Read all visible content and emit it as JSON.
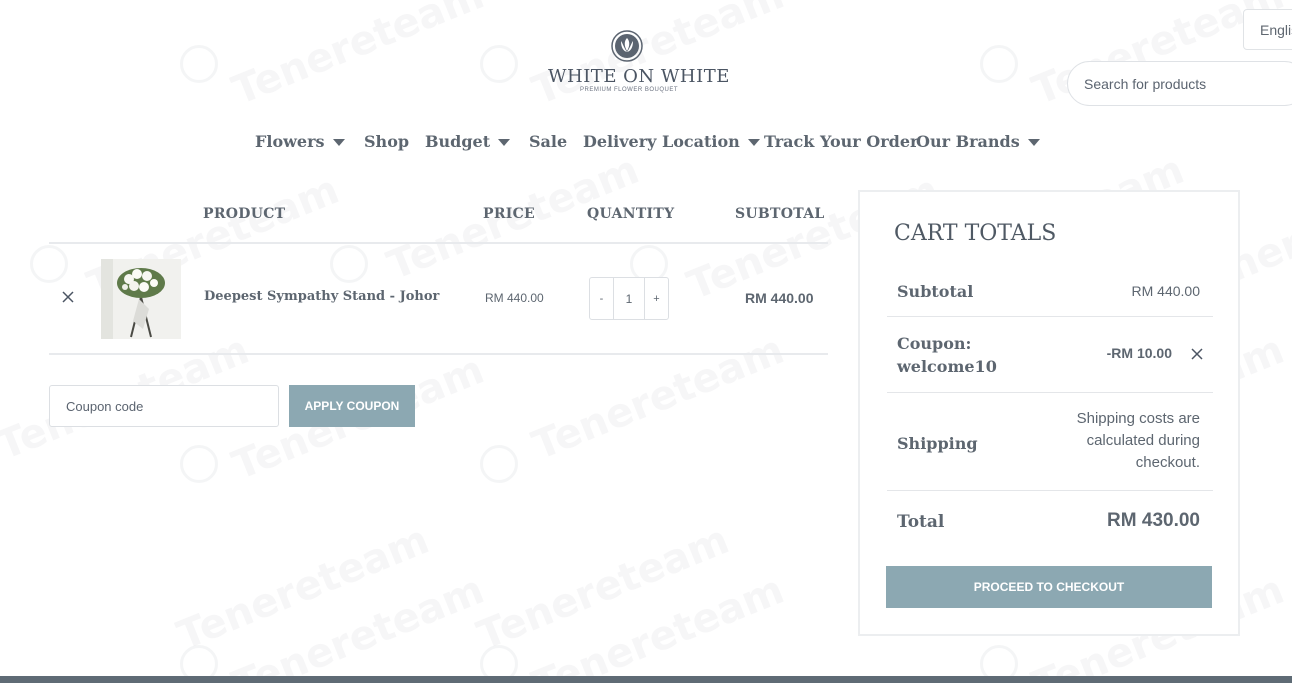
{
  "header": {
    "language": "English",
    "search_placeholder": "Search for products",
    "logo": {
      "name": "WHITE ON WHITE",
      "tagline": "PREMIUM FLOWER BOUQUET"
    }
  },
  "nav": {
    "items": [
      {
        "label": "Flowers",
        "dropdown": true
      },
      {
        "label": "Shop",
        "dropdown": false
      },
      {
        "label": "Budget",
        "dropdown": true
      },
      {
        "label": "Sale",
        "dropdown": false
      },
      {
        "label": "Delivery Location",
        "dropdown": true
      },
      {
        "label": "Track Your Order",
        "dropdown": false
      },
      {
        "label": "Our Brands",
        "dropdown": true
      }
    ]
  },
  "cart": {
    "headers": {
      "product": "PRODUCT",
      "price": "PRICE",
      "quantity": "QUANTITY",
      "subtotal": "SUBTOTAL"
    },
    "items": [
      {
        "name": "Deepest Sympathy Stand - Johor",
        "price": "RM 440.00",
        "quantity": "1",
        "subtotal": "RM 440.00"
      }
    ],
    "qty_minus": "-",
    "qty_plus": "+",
    "coupon_placeholder": "Coupon code",
    "apply_coupon_label": "APPLY COUPON"
  },
  "totals": {
    "title": "CART TOTALS",
    "subtotal_label": "Subtotal",
    "subtotal_value": "RM 440.00",
    "coupon_label": "Coupon: welcome10",
    "coupon_value": "-RM 10.00",
    "shipping_label": "Shipping",
    "shipping_value": "Shipping costs are calculated during checkout.",
    "total_label": "Total",
    "total_value": "RM 430.00",
    "checkout_label": "PROCEED TO CHECKOUT"
  },
  "watermark": {
    "text": "Tenereteam"
  },
  "colors": {
    "accent": "#8ca8b2",
    "text": "#5d6670",
    "border": "#e4e6e9",
    "footer": "#5f6b75"
  }
}
